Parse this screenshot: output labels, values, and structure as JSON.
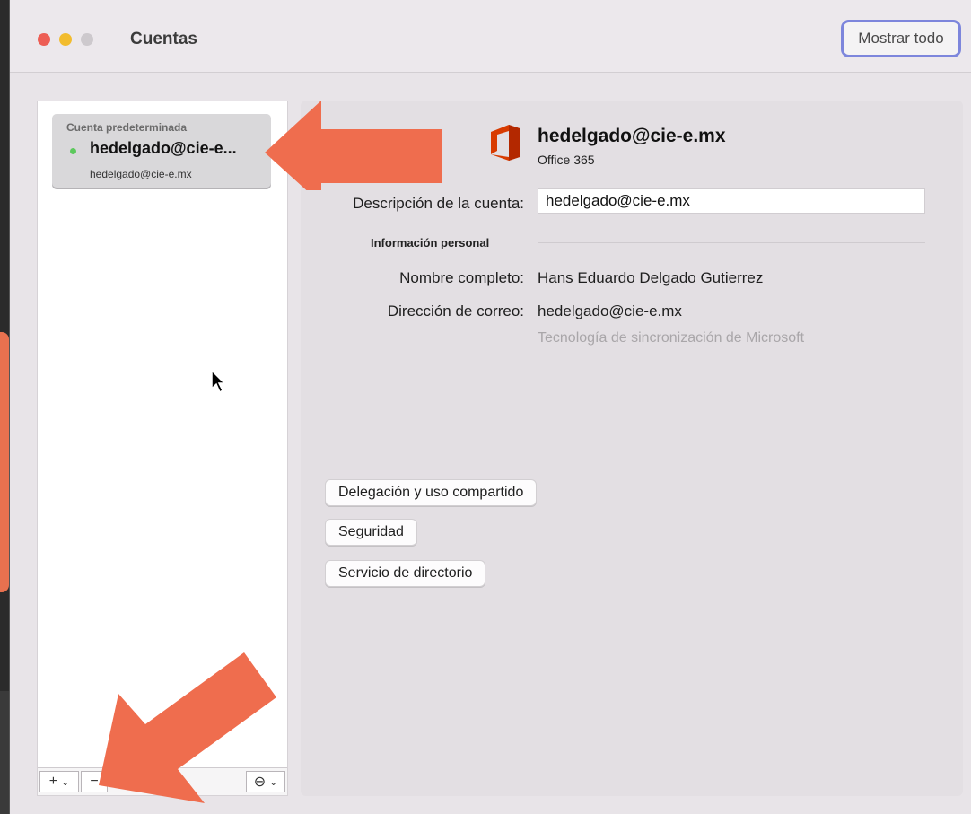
{
  "window": {
    "title": "Cuentas",
    "show_all": "Mostrar todo"
  },
  "sidebar": {
    "account": {
      "header": "Cuenta predeterminada",
      "name": "hedelgado@cie-e...",
      "email": "hedelgado@cie-e.mx",
      "status_color": "#5cc95c"
    },
    "toolbar": {
      "add": "+",
      "remove": "−",
      "more": "⊖"
    }
  },
  "detail": {
    "email_title": "hedelgado@cie-e.mx",
    "type": "Office 365",
    "description_label": "Descripción de la cuenta:",
    "description_value": "hedelgado@cie-e.mx",
    "personal_info_title": "Información personal",
    "full_name_label": "Nombre completo:",
    "full_name_value": "Hans Eduardo Delgado Gutierrez",
    "email_label": "Dirección de correo:",
    "email_value": "hedelgado@cie-e.mx",
    "sync_note": "Tecnología de sincronización de Microsoft",
    "buttons": {
      "delegation": "Delegación y uso compartido",
      "security": "Seguridad",
      "directory": "Servicio de directorio"
    }
  },
  "colors": {
    "annotation_arrow": "#ef6d4e",
    "focus_ring": "#7d86dc",
    "close": "#ed5e55",
    "minimize": "#f2bc2e"
  }
}
